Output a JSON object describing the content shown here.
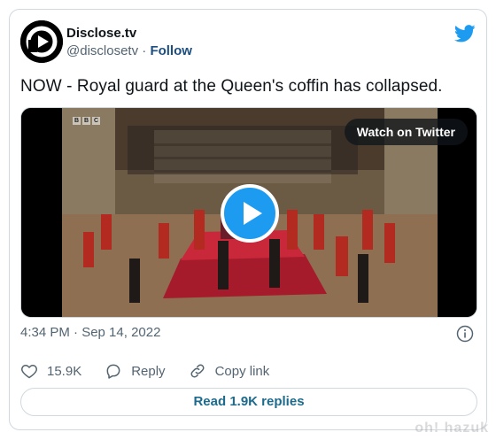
{
  "author": {
    "display_name": "Disclose.tv",
    "handle": "@disclosetv",
    "separator": "·",
    "follow_label": "Follow"
  },
  "tweet": {
    "text": "NOW - Royal guard at the Queen's coffin has collapsed."
  },
  "media": {
    "watch_label": "Watch on Twitter",
    "bbc_letters": [
      "B",
      "B",
      "C"
    ]
  },
  "meta": {
    "timestamp": "4:34 PM · Sep 14, 2022"
  },
  "actions": {
    "likes_count": "15.9K",
    "reply_label": "Reply",
    "copy_link_label": "Copy link"
  },
  "replies_button": {
    "label": "Read 1.9K replies"
  },
  "watermark": {
    "text": "oh! hazuk"
  },
  "colors": {
    "twitter_blue": "#1d9bf0",
    "text_primary": "#0f1419",
    "text_secondary": "#536471",
    "border": "#cfd9de"
  },
  "icons": [
    "disclose-logo-icon",
    "twitter-bird-icon",
    "play-icon",
    "info-icon",
    "heart-icon",
    "reply-icon",
    "link-icon"
  ]
}
